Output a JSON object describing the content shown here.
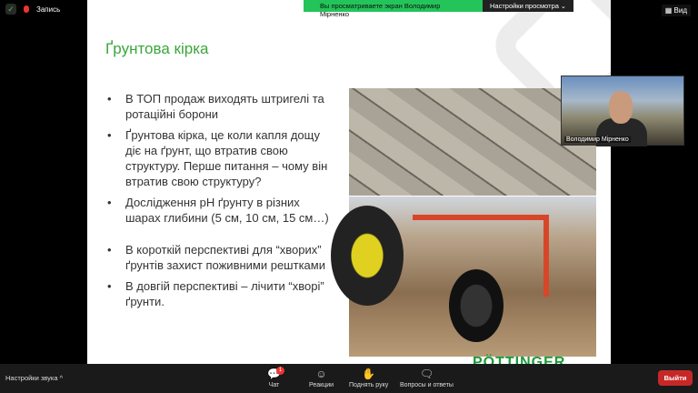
{
  "top": {
    "record_label": "Запись",
    "banner_text": "Вы просматриваете экран Володимир Мірненко",
    "view_settings": "Настройки просмотра",
    "view_label": "Вид"
  },
  "slide": {
    "title": "Ґрунтова кірка",
    "bullets": [
      "В ТОП продаж виходять штригелі та ротаційні борони",
      "Ґрунтова кірка, це коли капля дощу діє на ґрунт, що втратив свою структуру. Перше питання – чому він втратив свою структуру?",
      "Дослідження pH ґрунту в різних шарах глибини (5 см, 10 см, 15 см…)",
      "В короткій перспективі для “хворих” ґрунтів захист поживними рештками",
      "В довгій перспективі – лічити “хворі” ґрунти."
    ],
    "logo": "PÖTTINGER"
  },
  "video": {
    "name": "Володимир Мірненко"
  },
  "bottom": {
    "audio": "Настройки звука",
    "chat": "Чат",
    "chat_badge": "1",
    "reactions": "Реакции",
    "raise_hand": "Поднять руку",
    "qa": "Вопросы и ответы",
    "exit": "Выйти"
  }
}
